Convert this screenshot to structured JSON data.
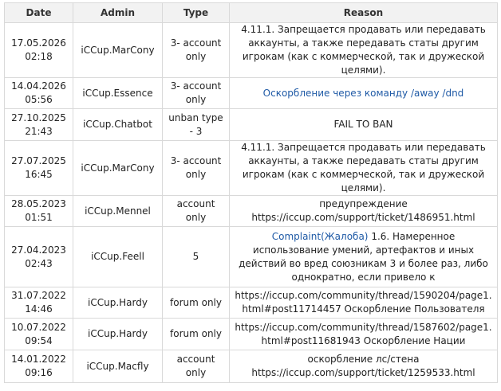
{
  "headers": {
    "date": "Date",
    "admin": "Admin",
    "type": "Type",
    "reason": "Reason"
  },
  "rows": [
    {
      "date": "17.05.2026",
      "time": "02:18",
      "admin": "iCCup.MarCony",
      "type_line1": "3- account",
      "type_line2": "only",
      "reason_prefix": "",
      "reason": "4.11.1. Запрещается продавать или передавать аккаунты, а также передавать статы другим игрокам (как с коммерческой, так и дружеской целями)."
    },
    {
      "date": "14.04.2026",
      "time": "05:56",
      "admin": "iCCup.Essence",
      "type_line1": "3- account",
      "type_line2": "only",
      "reason_prefix": "",
      "reason": "Оскорбление через команду /away /dnd"
    },
    {
      "date": "27.10.2025",
      "time": "21:43",
      "admin": "iCCup.Chatbot",
      "type_line1": "unban type - 3",
      "type_line2": "",
      "reason_prefix": "",
      "reason": "FAIL TO BAN"
    },
    {
      "date": "27.07.2025",
      "time": "16:45",
      "admin": "iCCup.MarCony",
      "type_line1": "3- account",
      "type_line2": "only",
      "reason_prefix": "",
      "reason": "4.11.1. Запрещается продавать или передавать аккаунты, а также передавать статы другим игрокам (как с коммерческой, так и дружеской целями)."
    },
    {
      "date": "28.05.2023",
      "time": "01:51",
      "admin": "iCCup.Mennel",
      "type_line1": "account only",
      "type_line2": "",
      "reason_prefix": "",
      "reason": "предупреждение https://iccup.com/support/ticket/1486951.html"
    },
    {
      "date": "27.04.2023",
      "time": "02:43",
      "admin": "iCCup.Feell",
      "type_line1": "5",
      "type_line2": "",
      "reason_prefix": "Complaint(Жалоба)",
      "reason": " 1.6. Намеренное использование умений, артефактов и иных действий во вред союзникам 3 и более раз, либо однократно, если привело к"
    },
    {
      "date": "31.07.2022",
      "time": "14:46",
      "admin": "iCCup.Hardy",
      "type_line1": "forum only",
      "type_line2": "",
      "reason_prefix": "",
      "reason": "https://iccup.com/community/thread/1590204/page1.html#post11714457 Оскорбление Пользователя"
    },
    {
      "date": "10.07.2022",
      "time": "09:54",
      "admin": "iCCup.Hardy",
      "type_line1": "forum only",
      "type_line2": "",
      "reason_prefix": "",
      "reason": "https://iccup.com/community/thread/1587602/page1.html#post11681943 Оскорбление Нации"
    },
    {
      "date": "14.01.2022",
      "time": "09:16",
      "admin": "iCCup.Macfly",
      "type_line1": "account only",
      "type_line2": "",
      "reason_prefix": "",
      "reason": "оскорбление лс/стена https://iccup.com/support/ticket/1259533.html"
    }
  ],
  "colors": {
    "header_bg": "#f2f2f2",
    "border": "#d9d9d9",
    "link_blue": "#1f5aa6"
  }
}
